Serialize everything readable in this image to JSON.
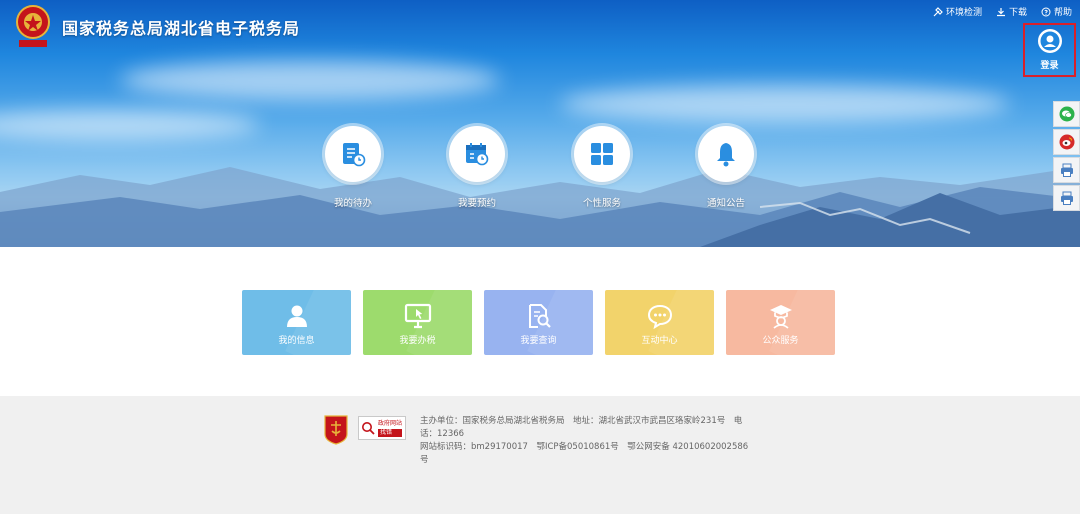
{
  "header": {
    "site_title": "国家税务总局湖北省电子税务局",
    "links": [
      {
        "label": "环境检测",
        "icon": "tools-icon"
      },
      {
        "label": "下载",
        "icon": "download-icon"
      },
      {
        "label": "帮助",
        "icon": "help-icon"
      }
    ],
    "login_label": "登录"
  },
  "quick_links": [
    {
      "label": "我的待办",
      "icon": "todo-list-icon"
    },
    {
      "label": "我要预约",
      "icon": "calendar-clock-icon"
    },
    {
      "label": "个性服务",
      "icon": "grid-icon"
    },
    {
      "label": "通知公告",
      "icon": "bell-icon"
    }
  ],
  "side_tools": [
    {
      "icon": "wechat-icon",
      "color": "#2cb24b"
    },
    {
      "icon": "weibo-icon",
      "color": "#d52a2a"
    },
    {
      "icon": "printer-icon",
      "color": "#4a7fc1"
    },
    {
      "icon": "printer-icon",
      "color": "#4a7fc1"
    }
  ],
  "cards": [
    {
      "label": "我的信息",
      "icon": "user-icon",
      "color": "#6fbde8"
    },
    {
      "label": "我要办税",
      "icon": "monitor-cursor-icon",
      "color": "#9ddb6d"
    },
    {
      "label": "我要查询",
      "icon": "document-search-icon",
      "color": "#98b3f0"
    },
    {
      "label": "互动中心",
      "icon": "chat-bubble-icon",
      "color": "#f2d36b"
    },
    {
      "label": "公众服务",
      "icon": "graduate-icon",
      "color": "#f7b9a0"
    }
  ],
  "footer": {
    "badge_top": "政府网站",
    "badge_bottom": "找错",
    "line1": "主办单位：国家税务总局湖北省税务局　地址：湖北省武汉市武昌区珞家岭231号　电话：12366",
    "line2": "网站标识码：bm29170017　鄂ICP备05010861号　鄂公网安备 42010602002586号"
  },
  "colors": {
    "sky_top": "#0e5fc4",
    "login_border": "#d9202a",
    "footer_bg": "#f0f0f0",
    "quick_icon": "#2a8ee0"
  }
}
